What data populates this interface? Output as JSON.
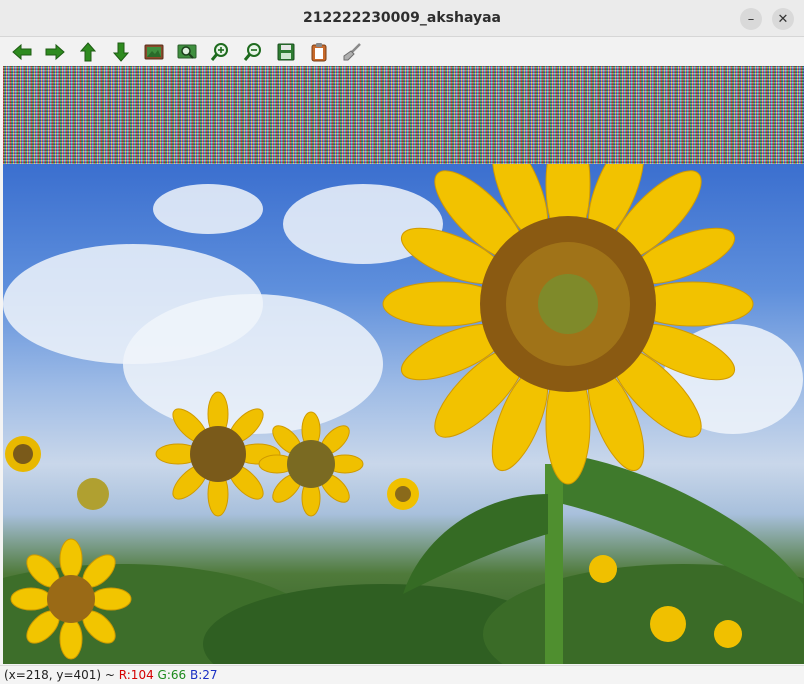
{
  "window": {
    "title": "212222230009_akshayaa"
  },
  "controls": {
    "minimize": "–",
    "close": "✕"
  },
  "toolbar": {
    "items": [
      {
        "icon": "arrow-left-icon"
      },
      {
        "icon": "arrow-right-icon"
      },
      {
        "icon": "arrow-up-icon"
      },
      {
        "icon": "arrow-down-icon"
      },
      {
        "icon": "image-icon"
      },
      {
        "icon": "image-zoom-icon"
      },
      {
        "icon": "zoom-in-icon"
      },
      {
        "icon": "zoom-out-icon"
      },
      {
        "icon": "save-icon"
      },
      {
        "icon": "clipboard-icon"
      },
      {
        "icon": "brush-icon"
      }
    ]
  },
  "status": {
    "coords": "(x=218, y=401) ~ ",
    "r": "R:104",
    "g": "G:66",
    "b": "B:27"
  },
  "colors": {
    "arrow_green": "#2e8b1f",
    "save_green": "#2e7d32",
    "status_r": "#d40000",
    "status_g": "#1c8a1c",
    "status_b": "#1a2fc4"
  }
}
